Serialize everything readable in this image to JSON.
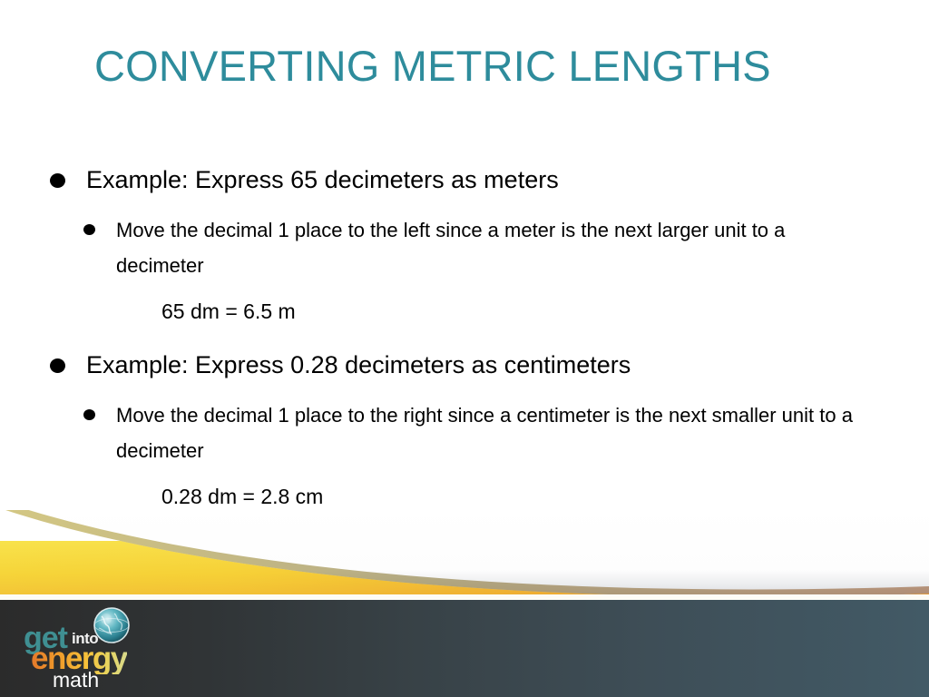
{
  "slide": {
    "title": "CONVERTING METRIC LENGTHS",
    "blocks": [
      {
        "bullet_label": "bullet-point",
        "heading": "Example: Express 65 decimeters as meters",
        "detail": "Move the decimal 1 place to the left since a meter is the next larger unit to a decimeter",
        "equation": "65 dm = 6.5 m"
      },
      {
        "bullet_label": "bullet-point",
        "heading": "Example: Express 0.28 decimeters as centimeters",
        "detail": "Move the decimal 1 place to the right since a centimeter is the next smaller unit to a decimeter",
        "equation": "0.28 dm = 2.8 cm"
      }
    ]
  },
  "footer": {
    "logo": {
      "word_get": "get",
      "word_into": "into",
      "word_energy": "energy",
      "word_math": "math",
      "globe_icon": "globe-icon"
    }
  },
  "colors": {
    "title_teal": "#2e8c9c",
    "body_black": "#000000",
    "band_yellow": "#f6d93a",
    "band_orange": "#e58a2a",
    "footer_dark": "#2b2b2b",
    "footer_slate": "#425a66",
    "logo_get_teal": "#3f8f92",
    "logo_energy_orange": "#e4792b",
    "logo_energy_yellow": "#e8d55e",
    "page_white": "#ffffff"
  }
}
